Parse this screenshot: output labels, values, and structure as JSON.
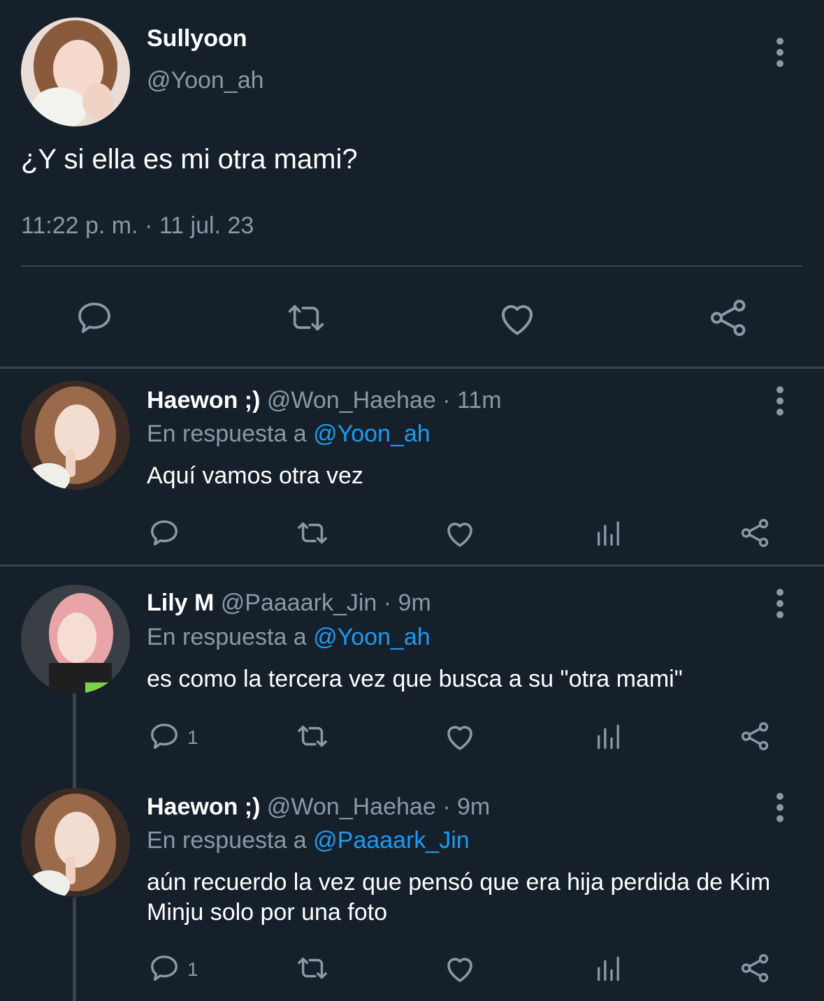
{
  "main": {
    "name": "Sullyoon",
    "handle": "@Yoon_ah",
    "text": "¿Y si ella es mi otra mami?",
    "timestamp": "11:22 p. m. · 11 jul. 23",
    "actions": [
      "reply-icon",
      "retweet-icon",
      "like-icon",
      "share-icon"
    ]
  },
  "replies": [
    {
      "name": "Haewon ;)",
      "handle": "@Won_Haehae",
      "time": "· 11m",
      "in_reply_prefix": "En respuesta a",
      "in_reply_to": "@Yoon_ah",
      "text": "Aquí vamos otra vez",
      "reply_count": ""
    },
    {
      "name": "Lily M",
      "handle": "@Paaaark_Jin",
      "time": "· 9m",
      "in_reply_prefix": "En respuesta a",
      "in_reply_to": "@Yoon_ah",
      "text": "es como la tercera vez que busca a su \"otra mami\"",
      "reply_count": "1"
    },
    {
      "name": "Haewon ;)",
      "handle": "@Won_Haehae",
      "time": "· 9m",
      "in_reply_prefix": "En respuesta a",
      "in_reply_to": "@Paaaark_Jin",
      "text": "aún recuerdo la vez que pensó que era hija perdida de Kim Minju solo por una foto",
      "reply_count": "1"
    }
  ],
  "colors": {
    "background": "#15202b",
    "muted": "#8b98a5",
    "link": "#1d9bf0",
    "divider": "#38444d"
  }
}
